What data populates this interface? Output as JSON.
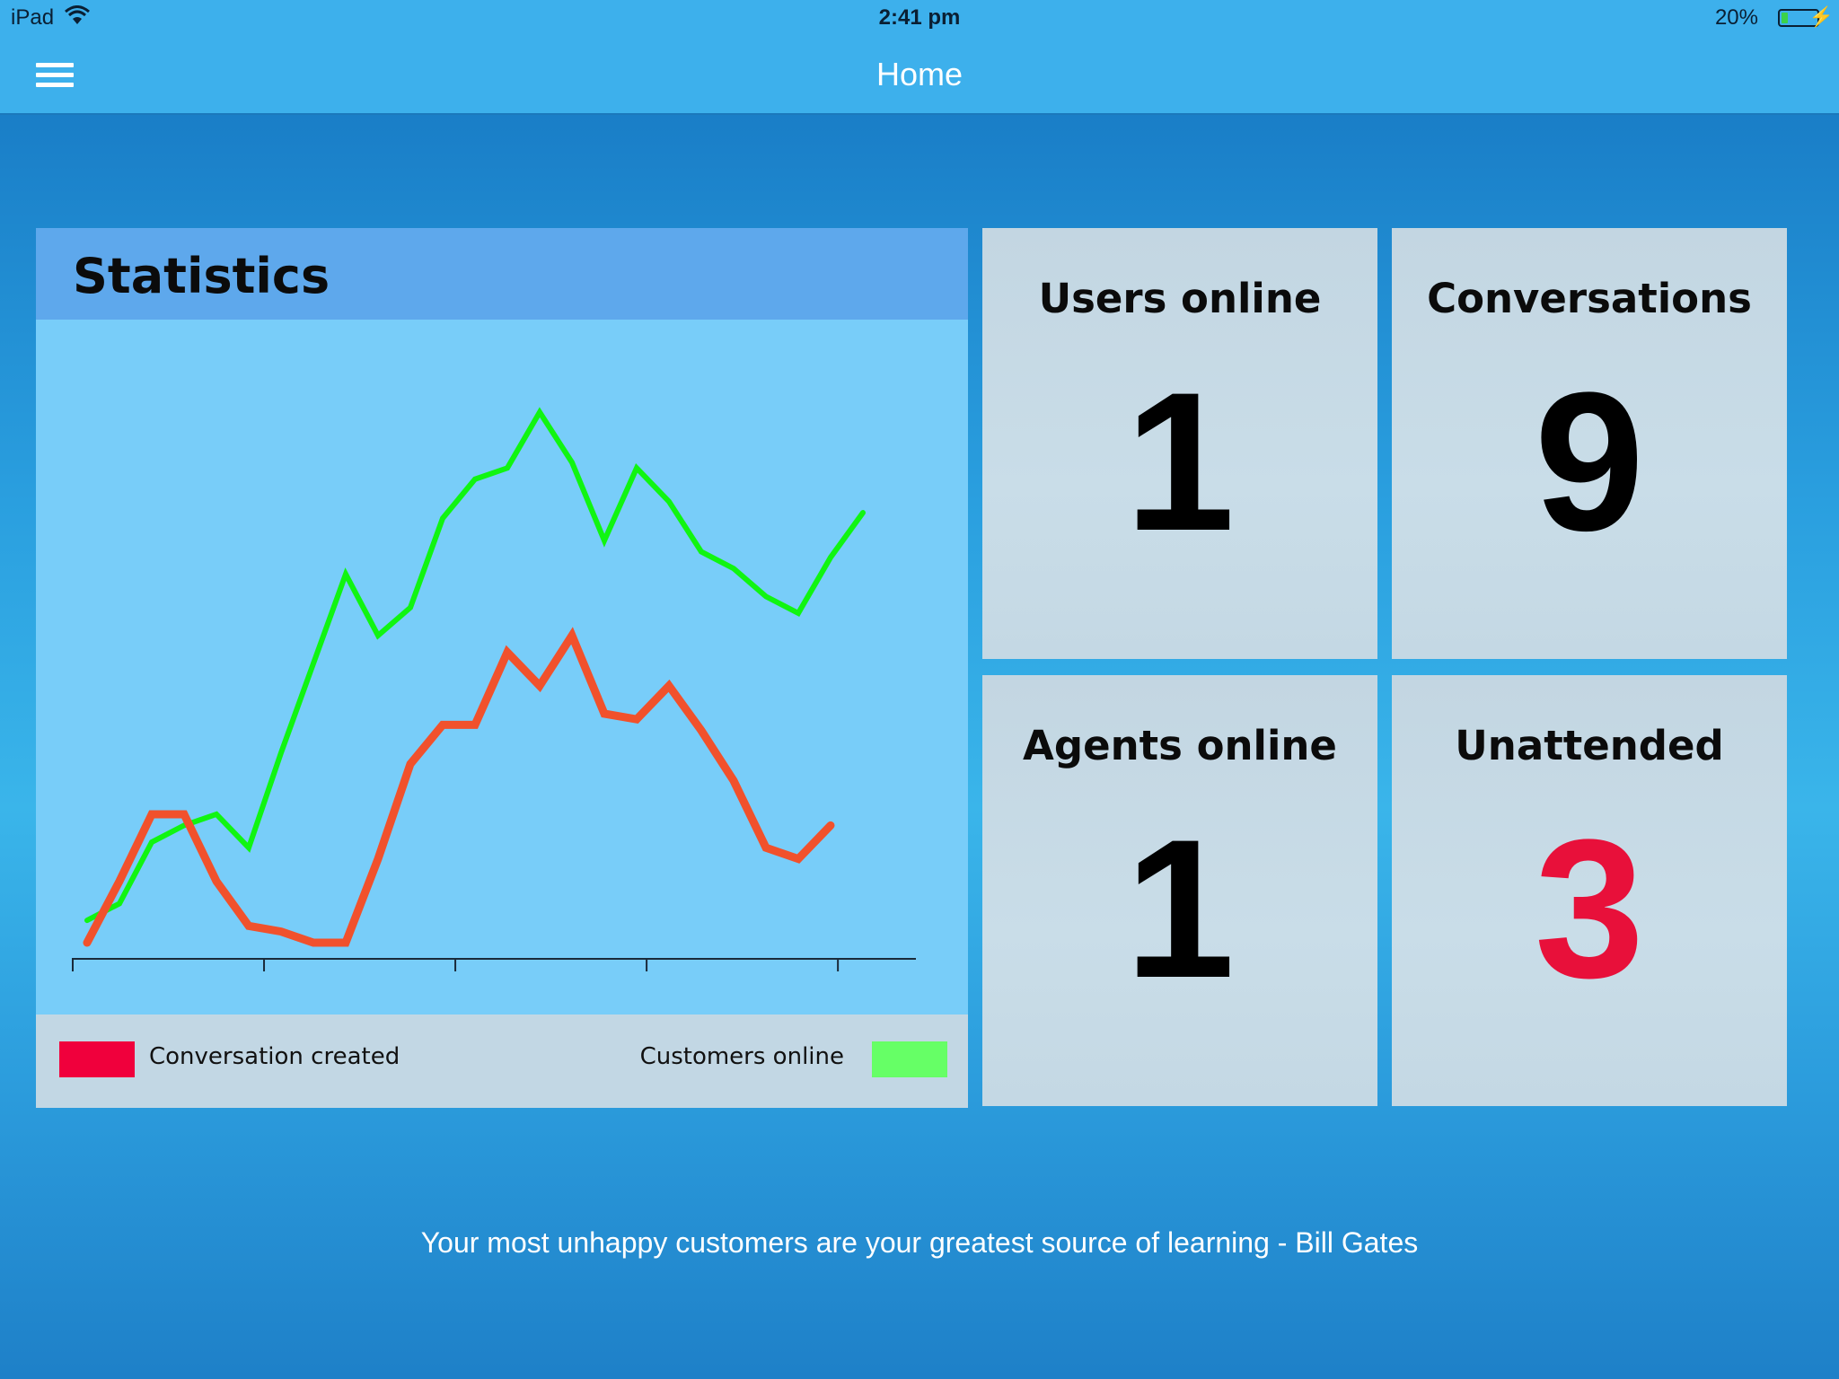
{
  "status_bar": {
    "carrier": "iPad",
    "time": "2:41 pm",
    "battery_percent": "20%",
    "battery_level": 0.2,
    "icons": [
      "wifi-icon",
      "battery-icon",
      "charging-bolt-icon"
    ]
  },
  "nav": {
    "title": "Home",
    "menu_icon": "hamburger-menu-icon"
  },
  "statistics": {
    "title": "Statistics",
    "legend": [
      {
        "label": "Conversation created",
        "color": "#f0003c"
      },
      {
        "label": "Customers online",
        "color": "#66ff66"
      }
    ]
  },
  "chart_data": {
    "type": "line",
    "title": "Statistics",
    "xlabel": "",
    "ylabel": "",
    "x_ticks": 5,
    "ylim": [
      0,
      100
    ],
    "grid": false,
    "legend_placement": "bottom",
    "series": [
      {
        "name": "Customers online",
        "color": "#11f511",
        "values": [
          4,
          7,
          18,
          21,
          23,
          17,
          34,
          50,
          66,
          55,
          60,
          76,
          83,
          85,
          95,
          86,
          72,
          85,
          79,
          70,
          67,
          62,
          59,
          69,
          77
        ]
      },
      {
        "name": "Conversation created",
        "color": "#f1512c",
        "values": [
          0,
          11,
          23,
          23,
          11,
          3,
          2,
          0,
          0,
          15,
          32,
          39,
          39,
          52,
          46,
          55,
          41,
          40,
          46,
          38,
          29,
          17,
          15,
          21
        ]
      }
    ]
  },
  "tiles": [
    {
      "label": "Users online",
      "value": "1",
      "alert": false
    },
    {
      "label": "Conversations",
      "value": "9",
      "alert": false
    },
    {
      "label": "Agents online",
      "value": "1",
      "alert": false
    },
    {
      "label": "Unattended",
      "value": "3",
      "alert": true
    }
  ],
  "footer": {
    "quote": "Your most unhappy customers are your greatest source of learning - Bill Gates"
  }
}
